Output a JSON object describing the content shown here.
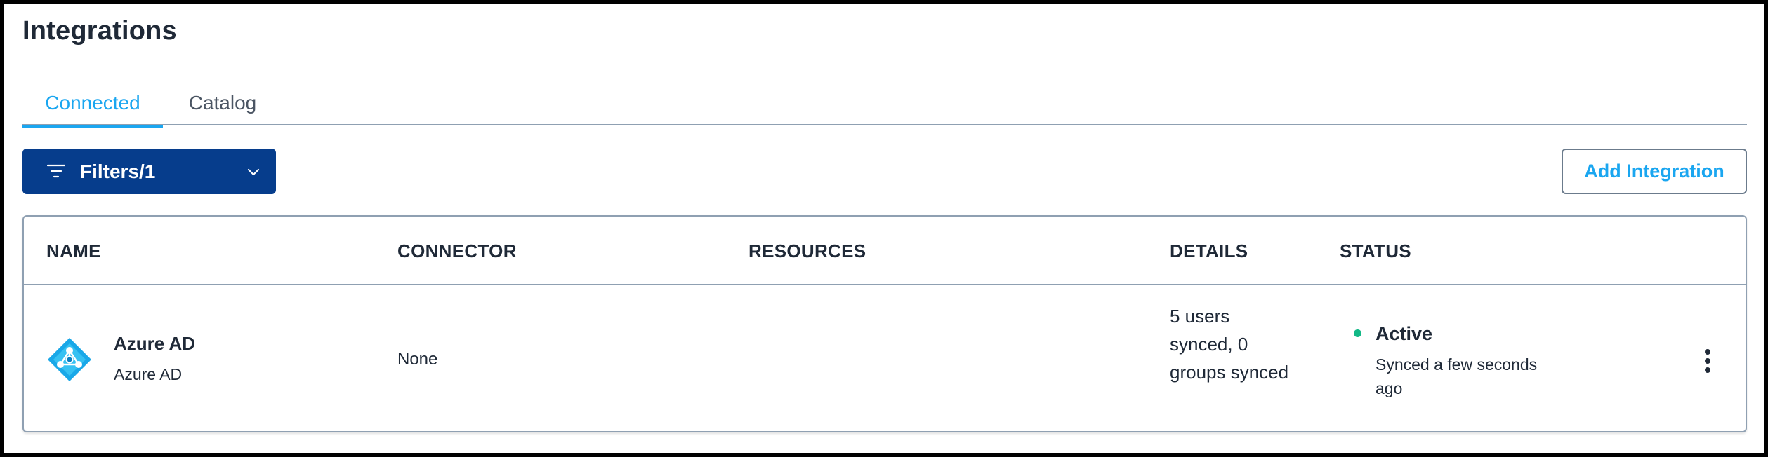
{
  "page": {
    "title": "Integrations"
  },
  "tabs": [
    {
      "label": "Connected",
      "active": true
    },
    {
      "label": "Catalog",
      "active": false
    }
  ],
  "toolbar": {
    "filters_label": "Filters/1",
    "filter_icon": "filter-lines-icon",
    "dropdown_icon": "chevron-down-icon",
    "add_label": "Add Integration"
  },
  "table": {
    "columns": [
      "NAME",
      "CONNECTOR",
      "RESOURCES",
      "DETAILS",
      "STATUS"
    ],
    "rows": [
      {
        "icon": "azure-ad-icon",
        "name": "Azure AD",
        "subname": "Azure AD",
        "connector": "None",
        "resources": "",
        "details": "5 users synced, 0 groups synced",
        "status": "Active",
        "status_detail": "Synced a few seconds ago",
        "status_color": "#12b886",
        "menu_icon": "kebab-menu-icon"
      }
    ]
  },
  "colors": {
    "accent": "#1aa6f0",
    "primary_button": "#063d8c",
    "border": "#8fa0b2",
    "status_active": "#12b886"
  }
}
